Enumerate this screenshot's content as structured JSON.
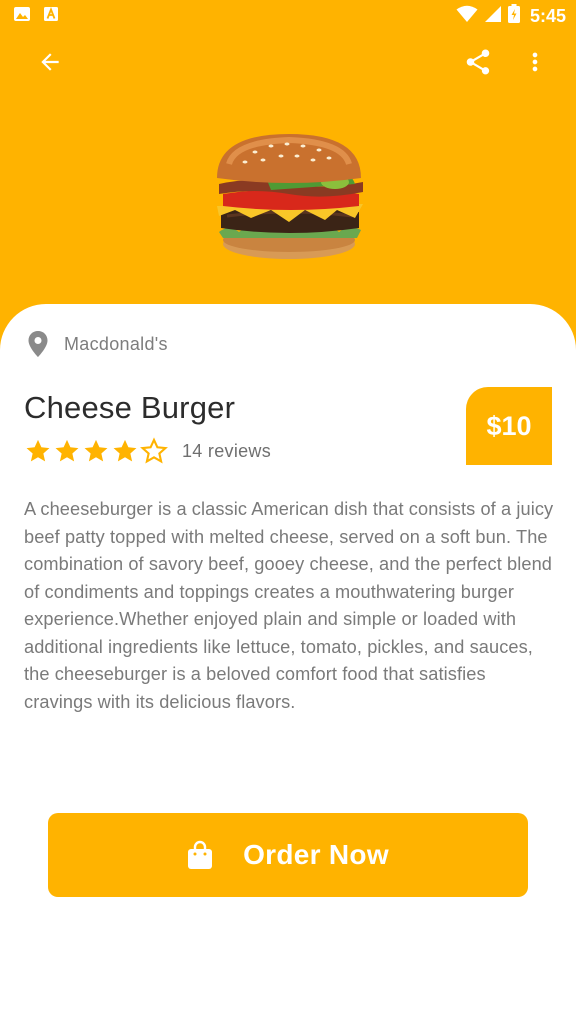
{
  "status_bar": {
    "time": "5:45",
    "icons": [
      "image-icon",
      "font-icon",
      "wifi-icon",
      "signal-icon",
      "battery-icon"
    ]
  },
  "app_bar": {
    "icons": [
      "arrow-left-icon",
      "share-icon",
      "more-vert-icon"
    ]
  },
  "product": {
    "restaurant": "Macdonald's",
    "name": "Cheese Burger",
    "price": "$10",
    "rating": 4,
    "rating_max": 5,
    "reviews": "14 reviews",
    "description": "A cheeseburger is a classic American dish that consists of a juicy beef patty topped with melted cheese, served on a soft bun. The combination of savory beef, gooey cheese, and the perfect blend of condiments and toppings creates a mouthwatering burger experience.Whether enjoyed plain and simple or loaded with additional ingredients like lettuce, tomato, pickles, and sauces, the cheeseburger is a beloved comfort food that satisfies cravings with its delicious flavors."
  },
  "order_button": {
    "label": "Order Now",
    "icon": "shopping-bag-icon"
  },
  "colors": {
    "accent": "#FFB300",
    "background": "#FFFFFF",
    "title": "#2C2C2C",
    "body_text": "#7A7A7A"
  }
}
